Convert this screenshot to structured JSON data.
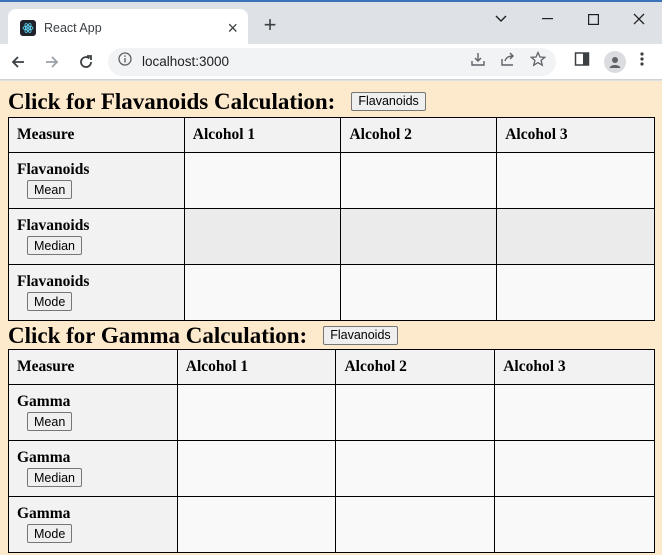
{
  "browser": {
    "tab_title": "React App",
    "url": "localhost:3000"
  },
  "flavanoids": {
    "heading": "Click for Flavanoids Calculation:",
    "button_label": "Flavanoids",
    "headers": [
      "Measure",
      "Alcohol 1",
      "Alcohol 2",
      "Alcohol 3"
    ],
    "rows": [
      {
        "label": "Flavanoids",
        "button": "Mean",
        "values": [
          "",
          "",
          ""
        ]
      },
      {
        "label": "Flavanoids",
        "button": "Median",
        "values": [
          "",
          "",
          ""
        ]
      },
      {
        "label": "Flavanoids",
        "button": "Mode",
        "values": [
          "",
          "",
          ""
        ]
      }
    ]
  },
  "gamma": {
    "heading": "Click for Gamma Calculation:",
    "button_label": "Flavanoids",
    "headers": [
      "Measure",
      "Alcohol 1",
      "Alcohol 2",
      "Alcohol 3"
    ],
    "rows": [
      {
        "label": "Gamma",
        "button": "Mean",
        "values": [
          "",
          "",
          ""
        ]
      },
      {
        "label": "Gamma",
        "button": "Median",
        "values": [
          "",
          "",
          ""
        ]
      },
      {
        "label": "Gamma",
        "button": "Mode",
        "values": [
          "",
          "",
          ""
        ]
      }
    ]
  }
}
